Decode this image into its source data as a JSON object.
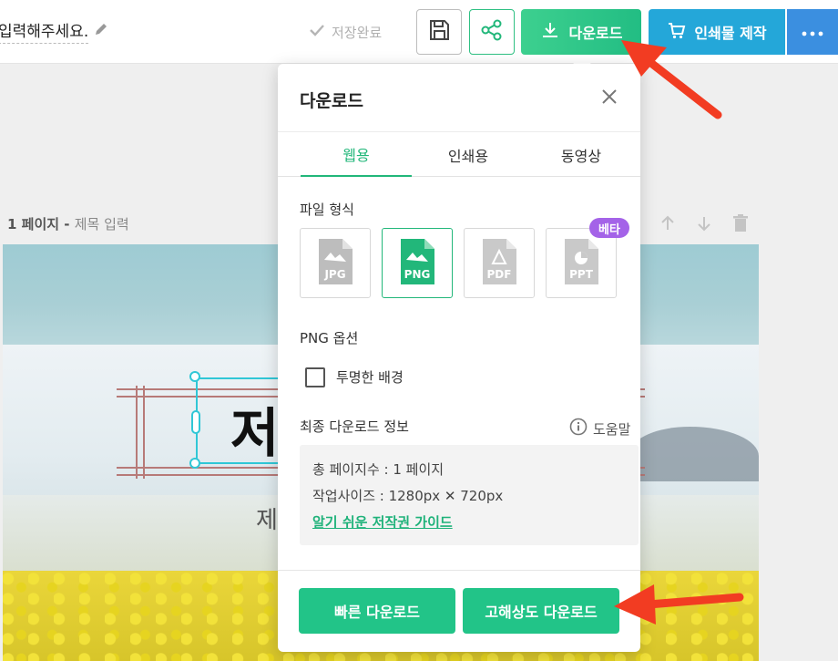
{
  "toolbar": {
    "doc_title": "입력해주세요.",
    "save_status": "저장완료",
    "download_label": "다운로드",
    "print_label": "인쇄물 제작"
  },
  "page": {
    "label": "1 페이지",
    "separator": " - ",
    "title_placeholder": "제목 입력"
  },
  "canvas": {
    "main_text": "저",
    "sub_text": "제"
  },
  "download_panel": {
    "title": "다운로드",
    "tabs": [
      {
        "label": "웹용",
        "active": true
      },
      {
        "label": "인쇄용",
        "active": false
      },
      {
        "label": "동영상",
        "active": false
      }
    ],
    "file_format_label": "파일 형식",
    "formats": [
      {
        "label": "JPG",
        "selected": false
      },
      {
        "label": "PNG",
        "selected": true
      },
      {
        "label": "PDF",
        "selected": false
      },
      {
        "label": "PPT",
        "selected": false
      }
    ],
    "beta_badge": "베타",
    "options_label": "PNG 옵션",
    "transparent_bg_label": "투명한 배경",
    "transparent_bg_checked": false,
    "info_label": "최종 다운로드 정보",
    "help_label": "도움말",
    "info": {
      "total_pages": "총 페이지수 : 1 페이지",
      "work_size": "작업사이즈 : 1280px ✕ 720px",
      "copyright_link": "알기 쉬운 저작권 가이드"
    },
    "fast_download": "빠른 다운로드",
    "hq_download": "고해상도 다운로드"
  },
  "colors": {
    "accent_green": "#22b77a",
    "print_blue": "#24a7d9",
    "beta_purple": "#a463e8",
    "annotation_red": "#f23c22"
  },
  "icons": {
    "title_edit": "pencil-icon",
    "saved": "check-icon",
    "save": "floppy-disk-icon",
    "share": "share-icon",
    "download": "download-icon",
    "print": "cart-icon",
    "more": "ellipsis-icon",
    "close": "close-icon",
    "help": "info-icon"
  }
}
